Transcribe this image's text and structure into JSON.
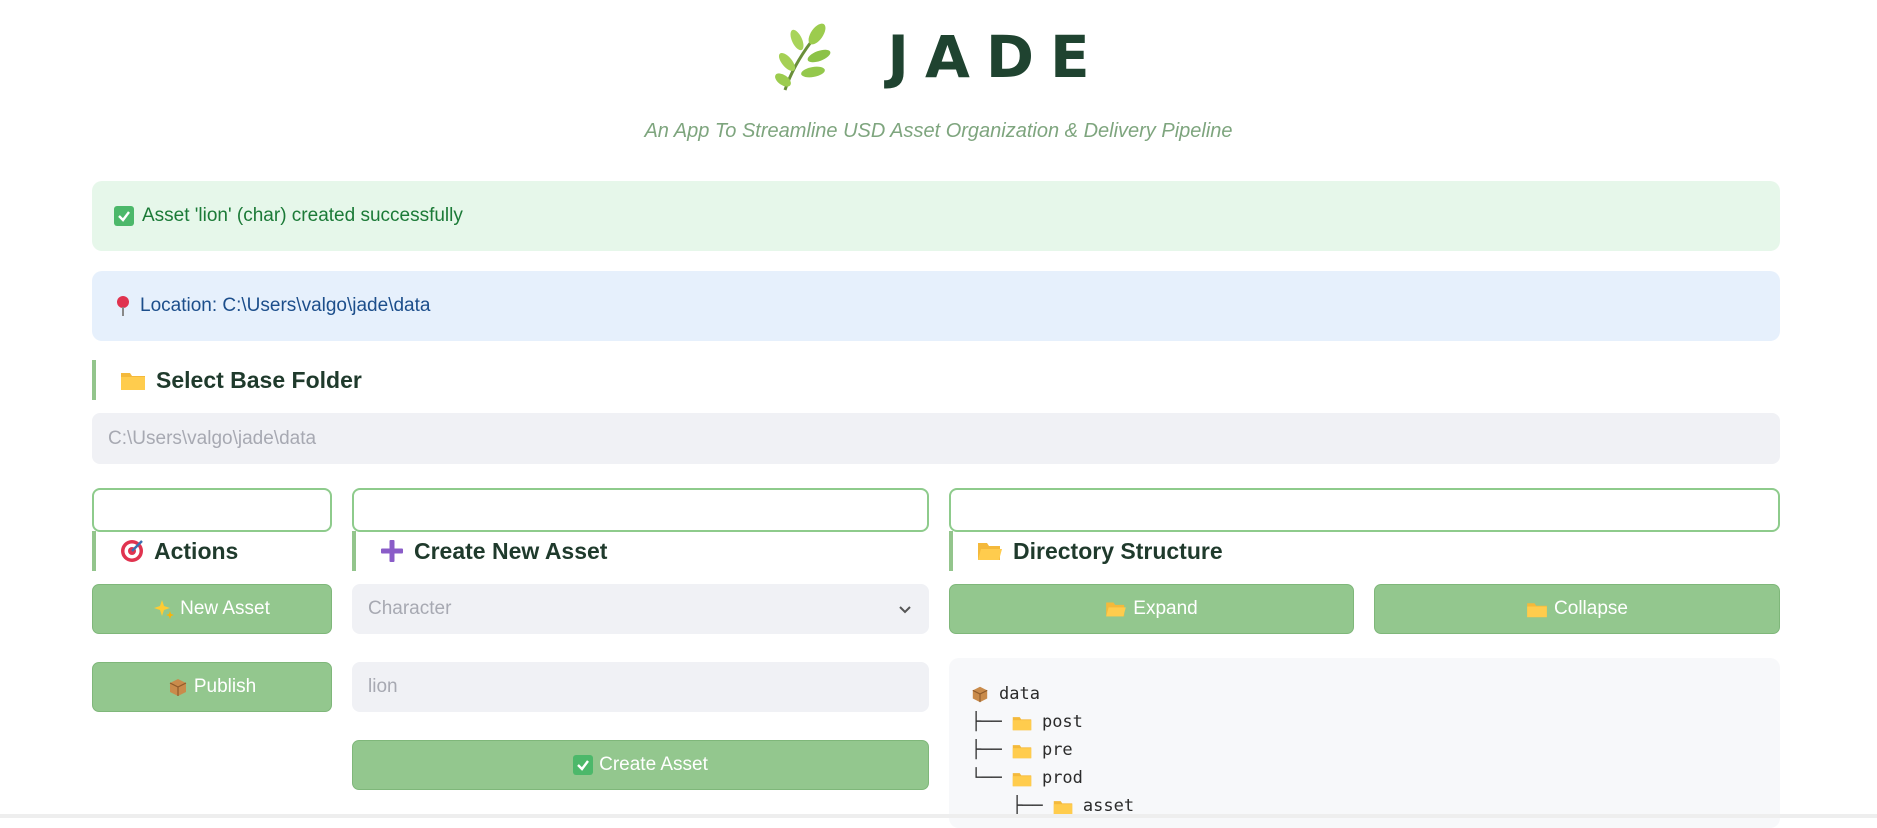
{
  "header": {
    "title": "JADE",
    "subtitle": "An App To Streamline USD Asset Organization & Delivery Pipeline",
    "logo_icon": "leaf-sprig-icon"
  },
  "alerts": {
    "success": "Asset 'lion' (char) created successfully",
    "info": "Location: C:\\Users\\valgo\\jade\\data"
  },
  "base_folder": {
    "heading": "Select Base Folder",
    "path_placeholder": "C:\\Users\\valgo\\jade\\data"
  },
  "actions": {
    "heading": "Actions",
    "new_asset": "New Asset",
    "publish": "Publish"
  },
  "create_asset": {
    "heading": "Create New Asset",
    "type_selected": "Character",
    "name_placeholder": "lion",
    "create_button": "Create Asset"
  },
  "directory": {
    "heading": "Directory Structure",
    "expand": "Expand",
    "collapse": "Collapse",
    "tree": [
      {
        "prefix": "",
        "name": "data",
        "icon": "package-icon"
      },
      {
        "prefix": "├── ",
        "name": "post",
        "icon": "folder-icon"
      },
      {
        "prefix": "├── ",
        "name": "pre",
        "icon": "folder-icon"
      },
      {
        "prefix": "└── ",
        "name": "prod",
        "icon": "folder-icon"
      },
      {
        "prefix": "    ├── ",
        "name": "asset",
        "icon": "folder-icon"
      }
    ]
  },
  "colors": {
    "accent_green": "#93c78e",
    "title_green": "#1f4330",
    "success_bg": "#e6f7ea",
    "info_bg": "#e6f0fc"
  }
}
